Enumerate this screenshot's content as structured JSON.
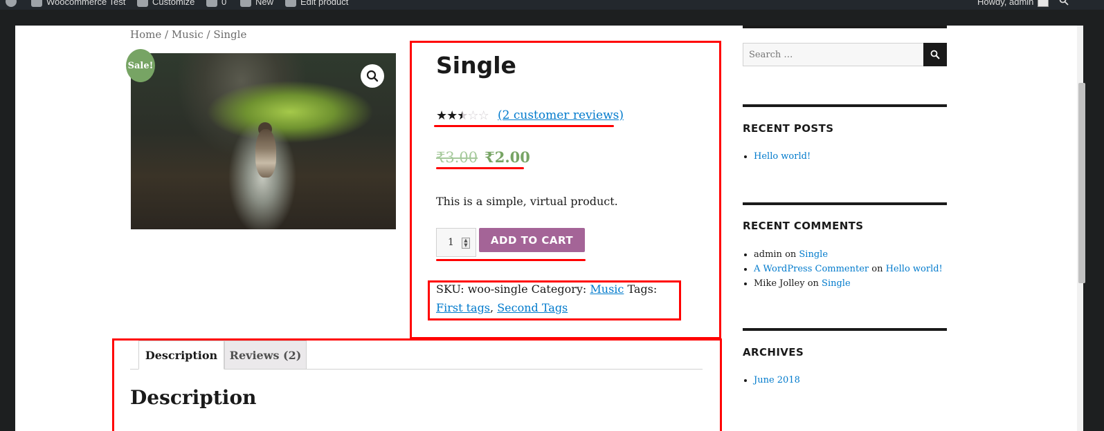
{
  "admin_bar": {
    "site_name": "Woocommerce Test",
    "customize": "Customize",
    "comments_count": "0",
    "new": "New",
    "edit_product": "Edit product",
    "howdy": "Howdy, admin"
  },
  "breadcrumb": {
    "home": "Home",
    "sep1": " / ",
    "category": "Music",
    "sep2": " / ",
    "current": "Single"
  },
  "product": {
    "sale_badge": "Sale!",
    "title": "Single",
    "rating": {
      "value": 2.5,
      "max": 5
    },
    "reviews_link": "(2 customer reviews)",
    "price_old": "₹3.00",
    "price_new": "₹2.00",
    "short_description": "This is a simple, virtual product.",
    "quantity": "1",
    "add_to_cart": "ADD TO CART",
    "meta": {
      "sku_label": "SKU: ",
      "sku": "woo-single",
      "category_label": " Category: ",
      "category": "Music",
      "tags_label": " Tags: ",
      "tag1": "First tags",
      "tag_sep": ", ",
      "tag2": "Second Tags"
    }
  },
  "tabs": [
    {
      "label": "Description",
      "active": true
    },
    {
      "label": "Reviews (2)",
      "active": false
    }
  ],
  "description_heading": "Description",
  "sidebar": {
    "search_placeholder": "Search …",
    "recent_posts": {
      "title": "RECENT POSTS",
      "items": [
        "Hello world!"
      ]
    },
    "recent_comments": {
      "title": "RECENT COMMENTS",
      "items": [
        {
          "author": "admin",
          "on": " on ",
          "post": "Single"
        },
        {
          "author": "A WordPress Commenter",
          "on": " on ",
          "post": "Hello world!"
        },
        {
          "author": "Mike Jolley",
          "on": " on ",
          "post": "Single"
        }
      ]
    },
    "archives": {
      "title": "ARCHIVES",
      "items": [
        "June 2018"
      ]
    }
  },
  "colors": {
    "annotation_red": "#ff0000",
    "sale_green": "#77a464",
    "button_purple": "#a46497",
    "link_blue": "#007acc"
  }
}
